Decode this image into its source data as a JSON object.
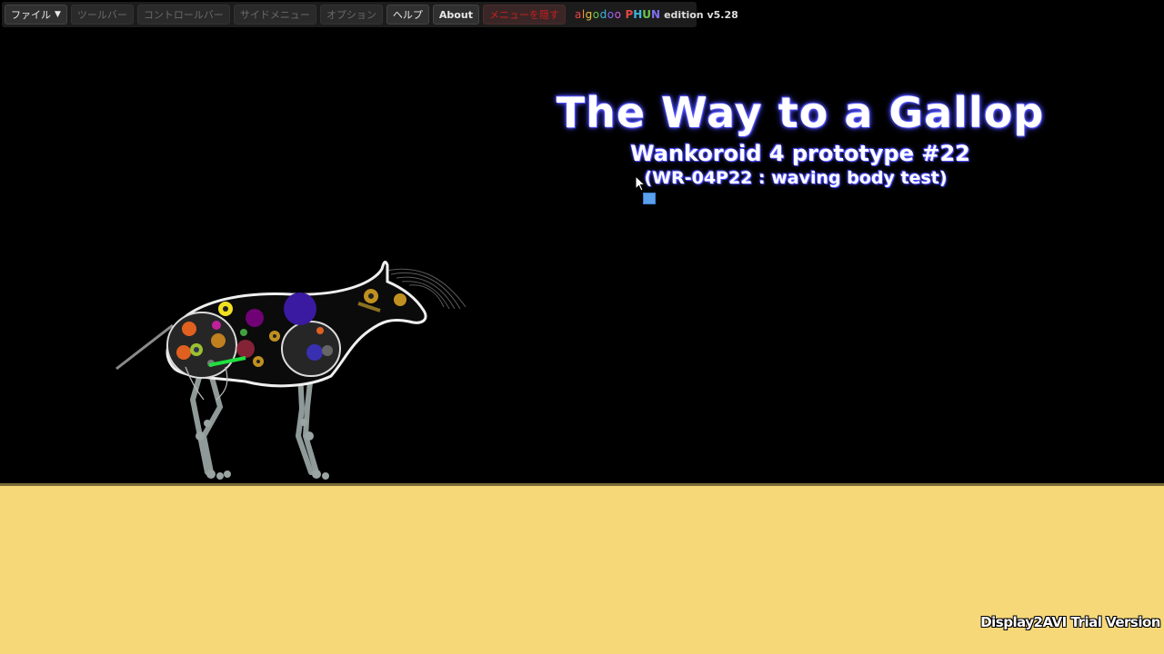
{
  "menubar": {
    "items": [
      {
        "label": "ファイル",
        "caret": "▼"
      },
      {
        "label": "ツールバー"
      },
      {
        "label": "コントロールバー"
      },
      {
        "label": "サイドメニュー"
      },
      {
        "label": "オプション"
      },
      {
        "label": "ヘルプ"
      },
      {
        "label": "About"
      },
      {
        "label": "メニューを隠す"
      }
    ],
    "brand": {
      "algodoo": [
        "a",
        "l",
        "g",
        "o",
        "d",
        "o",
        "o"
      ],
      "phun": [
        "P",
        "H",
        "U",
        "N"
      ],
      "edition": "edition v5.28"
    }
  },
  "titles": {
    "main": "The Way to a Gallop",
    "sub": "Wankoroid 4 prototype #22",
    "sub2": "(WR-04P22 : waving body test)"
  },
  "watermark": "Display2AVI Trial Version",
  "colors": {
    "background": "#000000",
    "ground": "#f6d878",
    "ground_edge": "#7a6a3a",
    "title_glow": "#4848ff"
  }
}
